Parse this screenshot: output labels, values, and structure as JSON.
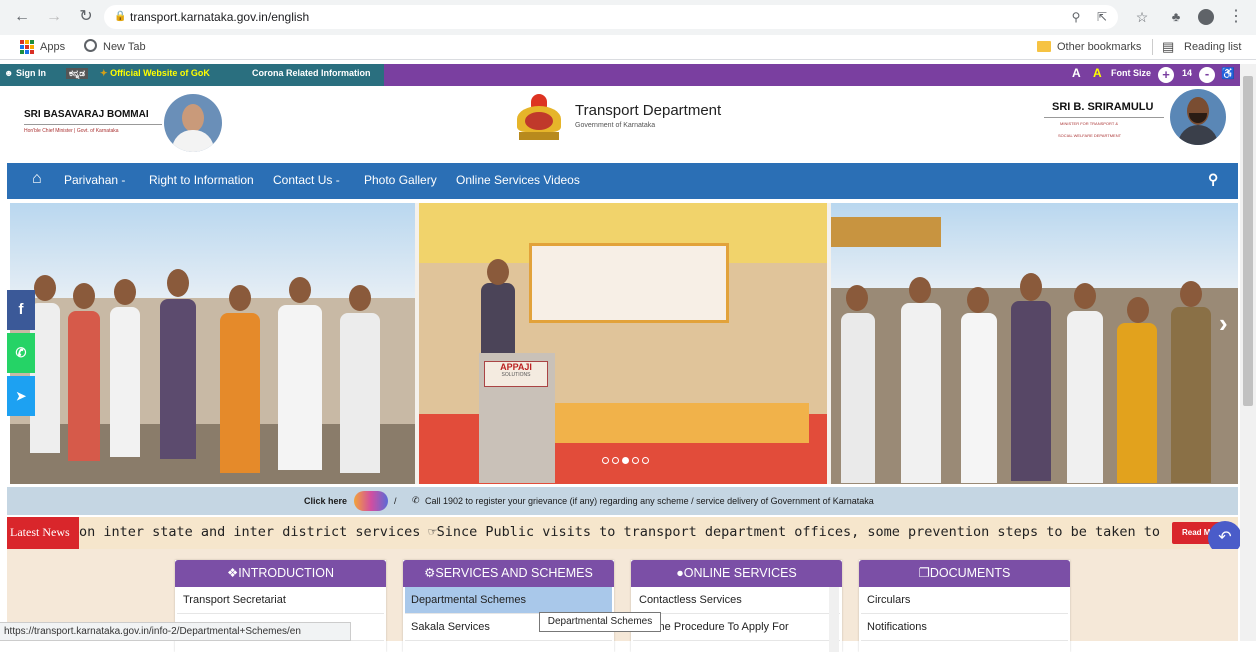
{
  "browser": {
    "url": "transport.karnataka.gov.in/english",
    "bookmarks": [
      "Apps",
      "New Tab"
    ],
    "right_bookmarks": [
      "Other bookmarks",
      "Reading list"
    ]
  },
  "top_strip": {
    "sign_in": "Sign In",
    "kannada": "ಕನ್ನಡ",
    "official": "Official Website of GoK",
    "corona": "Corona Related Information",
    "font_a1": "A",
    "font_a2": "A",
    "font_size_label": "Font Size",
    "font_size_value": "14"
  },
  "header": {
    "left_name": "SRI BASAVARAJ BOMMAI",
    "left_role": "Hon'ble Chief Minister | Govt. of Karnataka",
    "dept_title": "Transport Department",
    "dept_sub": "Government of Karnataka",
    "right_name": "SRI B. SRIRAMULU",
    "right_role1": "MINISTER FOR TRANSPORT &",
    "right_role2": "SOCIAL WELFARE DEPARTMENT"
  },
  "nav": {
    "items": [
      "Parivahan -",
      "Right to Information",
      "Contact Us -",
      "Photo Gallery",
      "Online Services Videos"
    ]
  },
  "banner": {
    "sign_text1": "APPAJI",
    "sign_text2": "SOLUTIONS"
  },
  "helpline": {
    "click_here": "Click here",
    "separator": "/",
    "call_text": "Call 1902 to register your grievance (if any) regarding any scheme / service delivery of Government of Karnataka"
  },
  "ticker": {
    "label": "Latest News",
    "text": "on inter state and inter district services    ☞Since Public visits to transport department offices, some prevention steps to be taken to p",
    "read_more": "Read M"
  },
  "cards": [
    {
      "title": "INTRODUCTION",
      "icon": "info-icon",
      "items": [
        "Transport Secretariat",
        ""
      ]
    },
    {
      "title": "SERVICES AND SCHEMES",
      "icon": "cogs-icon",
      "items": [
        "Departmental Schemes",
        "Sakala Services"
      ]
    },
    {
      "title": "ONLINE SERVICES",
      "icon": "globe-icon",
      "items": [
        "Contactless Services",
        "Online Procedure To Apply For"
      ]
    },
    {
      "title": "DOCUMENTS",
      "icon": "docs-icon",
      "items": [
        "Circulars",
        "Notifications"
      ]
    }
  ],
  "status_url": "https://transport.karnataka.gov.in/info-2/Departmental+Schemes/en",
  "tooltip": "Departmental Schemes",
  "colors": {
    "strip_purple": "#7a3fa0",
    "strip_teal": "#2a6f7f",
    "nav_blue": "#2b6fb5",
    "card_purple": "#7b4fa6",
    "news_red": "#d9262b"
  }
}
